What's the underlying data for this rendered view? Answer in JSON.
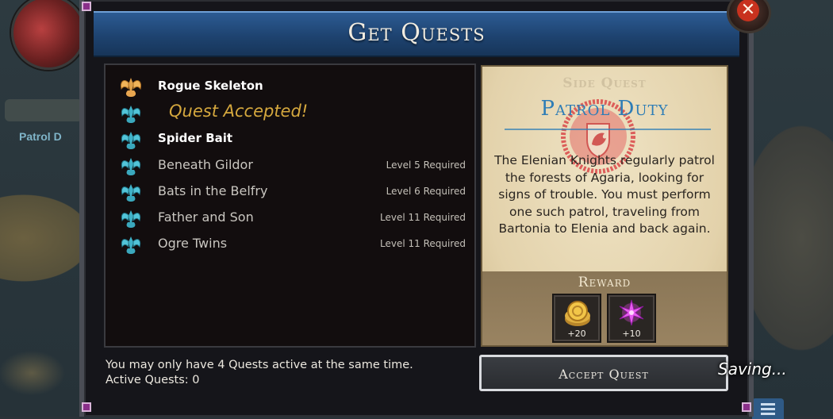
{
  "background": {
    "map_label": "Patrol D"
  },
  "dialog": {
    "title": "Get Quests",
    "close_icon": "close-x-icon"
  },
  "quests": [
    {
      "name": "Rogue Skeleton",
      "icon": "gold-wing-emblem-icon",
      "requirement": "",
      "style": "white"
    },
    {
      "name": "",
      "icon": "blue-wing-emblem-icon",
      "requirement": "",
      "status": "Quest Accepted!",
      "style": "accepted"
    },
    {
      "name": "Spider Bait",
      "icon": "blue-wing-emblem-icon",
      "requirement": "",
      "style": "white"
    },
    {
      "name": "Beneath Gildor",
      "icon": "blue-wing-emblem-icon",
      "requirement": "Level 5 Required",
      "style": "grey"
    },
    {
      "name": "Bats in the Belfry",
      "icon": "blue-wing-emblem-icon",
      "requirement": "Level 6 Required",
      "style": "grey"
    },
    {
      "name": "Father and Son",
      "icon": "blue-wing-emblem-icon",
      "requirement": "Level 11 Required",
      "style": "grey"
    },
    {
      "name": "Ogre Twins",
      "icon": "blue-wing-emblem-icon",
      "requirement": "Level 11 Required",
      "style": "grey"
    }
  ],
  "footer": {
    "limit_text": "You may only have 4 Quests active at the same time.",
    "active_text": "Active Quests: 0"
  },
  "detail": {
    "type": "Side Quest",
    "title": "Patrol Duty",
    "seal_icon": "red-dragon-seal-icon",
    "description": "The Elenian Knights regularly patrol the forests of Agaria, looking for signs of trouble. You must perform one such patrol, traveling from Bartonia to Elenia and back again.",
    "reward_label": "Reward",
    "rewards": [
      {
        "icon": "gold-coins-icon",
        "amount": "+20"
      },
      {
        "icon": "purple-star-icon",
        "amount": "+10"
      }
    ]
  },
  "accept_button": {
    "label": "Accept Quest"
  },
  "status": {
    "saving": "Saving..."
  },
  "colors": {
    "header_blue": "#1e4370",
    "accepted_gold": "#d5a83e",
    "title_blue": "#2e7db6",
    "parchment": "#e3d2ab",
    "close_red": "#c8321e"
  }
}
